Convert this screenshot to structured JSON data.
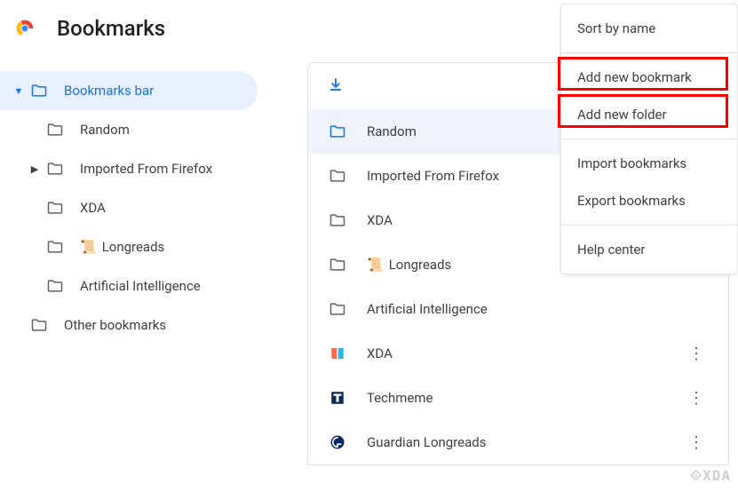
{
  "header": {
    "title": "Bookmarks"
  },
  "sidebar": {
    "items": [
      {
        "label": "Bookmarks bar",
        "expanded": true,
        "selected": true,
        "level": 1,
        "hasChildren": true
      },
      {
        "label": "Random",
        "level": 2,
        "hasChildren": false
      },
      {
        "label": "Imported From Firefox",
        "level": 2,
        "hasChildren": true,
        "collapsed": true
      },
      {
        "label": "XDA",
        "level": 2,
        "hasChildren": false
      },
      {
        "label": "Longreads",
        "prefix_emoji": "📜",
        "level": 2,
        "hasChildren": false
      },
      {
        "label": "Artificial Intelligence",
        "level": 2,
        "hasChildren": false
      },
      {
        "label": "Other bookmarks",
        "level": 1,
        "hasChildren": false
      }
    ]
  },
  "main": {
    "items": [
      {
        "label": "Random",
        "kind": "folder",
        "highlighted": true
      },
      {
        "label": "Imported From Firefox",
        "kind": "folder"
      },
      {
        "label": "XDA",
        "kind": "folder"
      },
      {
        "label": "Longreads",
        "prefix_emoji": "📜",
        "kind": "folder"
      },
      {
        "label": "Artificial Intelligence",
        "kind": "folder"
      },
      {
        "label": "XDA",
        "kind": "site-xda",
        "hasMore": true
      },
      {
        "label": "Techmeme",
        "kind": "site-techmeme",
        "hasMore": true
      },
      {
        "label": "Guardian Longreads",
        "kind": "site-guardian",
        "hasMore": true
      }
    ]
  },
  "menu": {
    "items": [
      {
        "label": "Sort by name"
      },
      {
        "divider": true
      },
      {
        "label": "Add new bookmark",
        "highlighted": true
      },
      {
        "label": "Add new folder",
        "highlighted": true
      },
      {
        "divider": true
      },
      {
        "label": "Import bookmarks"
      },
      {
        "label": "Export bookmarks"
      },
      {
        "divider": true
      },
      {
        "label": "Help center"
      }
    ]
  },
  "watermark": "⟐XDA"
}
